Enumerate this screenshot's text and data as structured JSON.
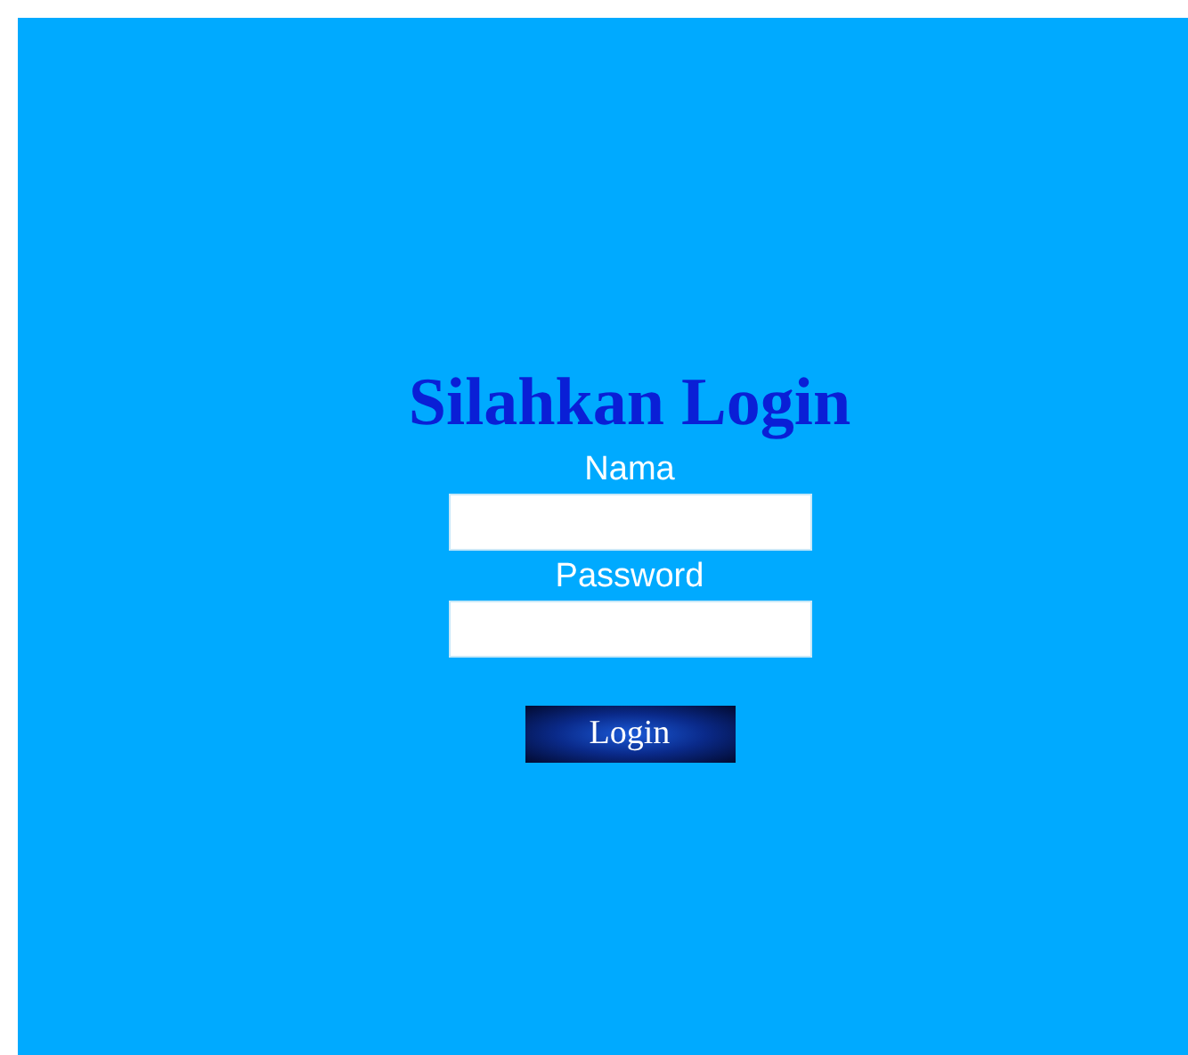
{
  "title": "Silahkan Login",
  "fields": [
    {
      "label": "Nama"
    },
    {
      "label": "Password"
    }
  ],
  "button": "Login"
}
